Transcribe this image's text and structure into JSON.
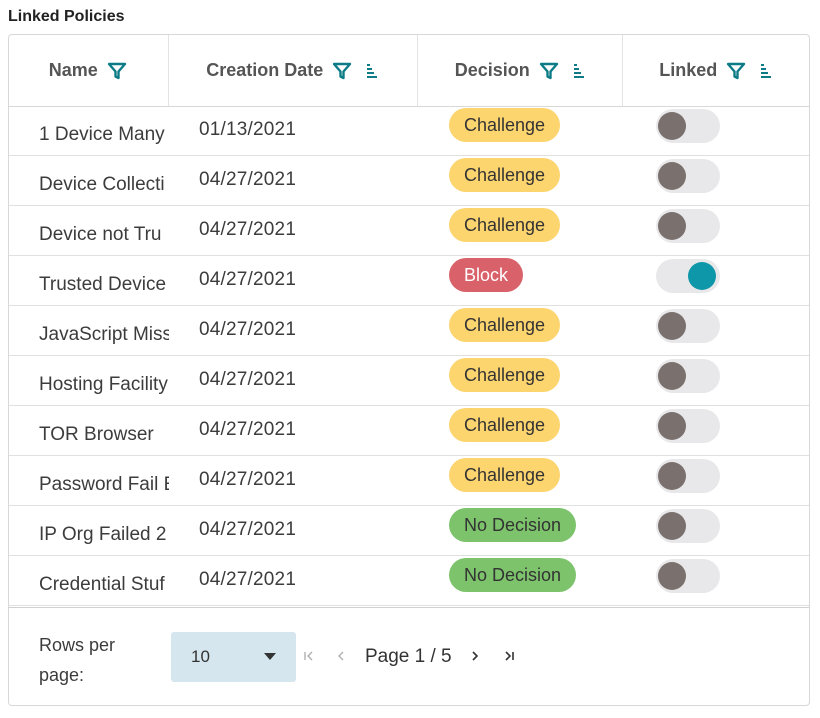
{
  "section_title": "Linked Policies",
  "colors": {
    "accent": "#0e7c86",
    "challenge": "#fdd56f",
    "block": "#d9616a",
    "no_decision": "#7cc36b",
    "toggle_on": "#0e97a8",
    "toggle_off_knob": "#7a706d"
  },
  "table": {
    "headers": {
      "name": "Name",
      "creation_date": "Creation Date",
      "decision": "Decision",
      "linked": "Linked"
    },
    "rows": [
      {
        "name": "1 Device Many",
        "date": "01/13/2021",
        "decision": "Challenge",
        "decision_type": "challenge",
        "linked": false
      },
      {
        "name": "Device Collecti",
        "date": "04/27/2021",
        "decision": "Challenge",
        "decision_type": "challenge",
        "linked": false
      },
      {
        "name": "Device not Tru",
        "date": "04/27/2021",
        "decision": "Challenge",
        "decision_type": "challenge",
        "linked": false
      },
      {
        "name": "Trusted Device",
        "date": "04/27/2021",
        "decision": "Block",
        "decision_type": "block",
        "linked": true
      },
      {
        "name": "JavaScript Miss",
        "date": "04/27/2021",
        "decision": "Challenge",
        "decision_type": "challenge",
        "linked": false
      },
      {
        "name": "Hosting Facility",
        "date": "04/27/2021",
        "decision": "Challenge",
        "decision_type": "challenge",
        "linked": false
      },
      {
        "name": "TOR Browser",
        "date": "04/27/2021",
        "decision": "Challenge",
        "decision_type": "challenge",
        "linked": false
      },
      {
        "name": "Password Fail E",
        "date": "04/27/2021",
        "decision": "Challenge",
        "decision_type": "challenge",
        "linked": false
      },
      {
        "name": "IP Org Failed 2",
        "date": "04/27/2021",
        "decision": "No Decision",
        "decision_type": "no_decision",
        "linked": false
      },
      {
        "name": "Credential Stuf",
        "date": "04/27/2021",
        "decision": "No Decision",
        "decision_type": "no_decision",
        "linked": false
      }
    ]
  },
  "pagination": {
    "rows_per_page_label": "Rows per page:",
    "rows_per_page_value": "10",
    "page_text": "Page 1 / 5"
  }
}
